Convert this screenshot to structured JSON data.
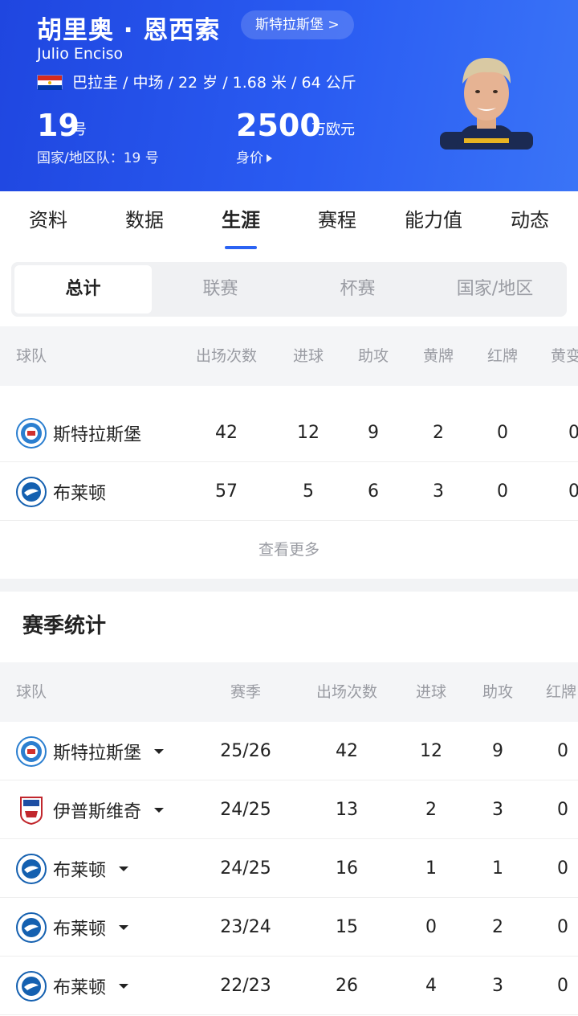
{
  "header": {
    "name_cn": "胡里奥 · 恩西索",
    "club_chip": "斯特拉斯堡 >",
    "name_en": "Julio Enciso",
    "info": "巴拉圭 / 中场 / 22 岁 / 1.68 米 / 64 公斤",
    "number": "19",
    "number_unit": "号",
    "national_number": "国家/地区队：19 号",
    "value": "2500",
    "value_unit": "万欧元",
    "value_label": "身价",
    "colors": {
      "bg_start": "#1f46e0",
      "bg_end": "#3a74f7"
    }
  },
  "tabs": [
    "资料",
    "数据",
    "生涯",
    "赛程",
    "能力值",
    "动态"
  ],
  "active_tab": "生涯",
  "segments": [
    "总计",
    "联赛",
    "杯赛",
    "国家/地区"
  ],
  "career": {
    "headers": [
      "球队",
      "出场次数",
      "进球",
      "助攻",
      "黄牌",
      "红牌",
      "黄变"
    ],
    "rows": [
      {
        "team": "斯特拉斯堡",
        "logo": "strasbourg-logo",
        "apps": "42",
        "goals": "12",
        "assists": "9",
        "yellow": "2",
        "red": "0",
        "yr": "0"
      },
      {
        "team": "布莱顿",
        "logo": "brighton-logo",
        "apps": "57",
        "goals": "5",
        "assists": "6",
        "yellow": "3",
        "red": "0",
        "yr": "0"
      }
    ],
    "more": "查看更多"
  },
  "season_stats": {
    "title": "赛季统计",
    "headers": [
      "球队",
      "赛季",
      "出场次数",
      "进球",
      "助攻",
      "红牌"
    ],
    "rows": [
      {
        "team": "斯特拉斯堡",
        "logo": "strasbourg-logo",
        "season": "25/26",
        "apps": "42",
        "goals": "12",
        "assists": "9",
        "red": "0"
      },
      {
        "team": "伊普斯维奇",
        "logo": "ipswich-logo",
        "season": "24/25",
        "apps": "13",
        "goals": "2",
        "assists": "3",
        "red": "0"
      },
      {
        "team": "布莱顿",
        "logo": "brighton-logo",
        "season": "24/25",
        "apps": "16",
        "goals": "1",
        "assists": "1",
        "red": "0"
      },
      {
        "team": "布莱顿",
        "logo": "brighton-logo",
        "season": "23/24",
        "apps": "15",
        "goals": "0",
        "assists": "2",
        "red": "0"
      },
      {
        "team": "布莱顿",
        "logo": "brighton-logo",
        "season": "22/23",
        "apps": "26",
        "goals": "4",
        "assists": "3",
        "red": "0"
      }
    ]
  }
}
